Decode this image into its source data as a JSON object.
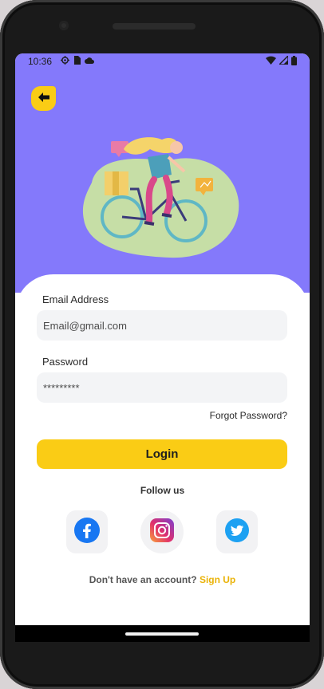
{
  "status_bar": {
    "time": "10:36"
  },
  "icons": {
    "back": "arrow-left-icon",
    "status_settings": "settings-icon",
    "status_sim": "sim-card-icon",
    "status_cloud": "cloud-icon",
    "wifi": "wifi-icon",
    "signal": "signal-icon",
    "battery": "battery-icon",
    "facebook": "facebook-icon",
    "instagram": "instagram-icon",
    "twitter": "twitter-icon"
  },
  "colors": {
    "hero_bg": "#8479fb",
    "accent": "#facc15",
    "link": "#eab308",
    "field_bg": "#f3f4f6"
  },
  "form": {
    "email_label": "Email Address",
    "email_value": "Email@gmail.com",
    "password_label": "Password",
    "password_value": "*********",
    "forgot_label": "Forgot Password?",
    "login_label": "Login"
  },
  "social": {
    "follow_label": "Follow us"
  },
  "footer": {
    "prompt": "Don't have an account?",
    "signup_label": "Sign Up"
  }
}
